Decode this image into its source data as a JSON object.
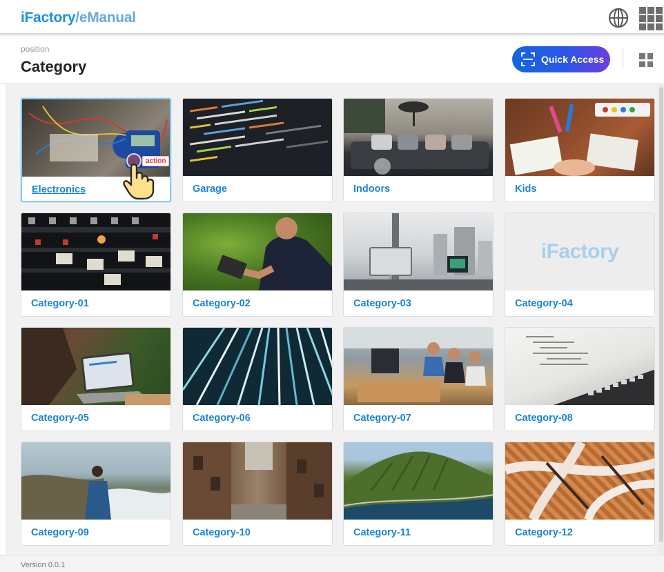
{
  "app": {
    "brand_primary": "iFactory",
    "brand_secondary": "/eManual",
    "globe_icon": "globe-icon",
    "apps_icon": "apps-grid-icon"
  },
  "header": {
    "position_label": "position",
    "title": "Category",
    "quick_access_label": "Quick Access",
    "view_toggle_icon": "grid-view-icon"
  },
  "colors": {
    "accent": "#1b84d8",
    "quick_access_gradient_start": "#1466e0",
    "quick_access_gradient_end": "#6c3fe0"
  },
  "categories": [
    {
      "label": "Electronics",
      "image": "electronics-breadboard-photo",
      "selected": true
    },
    {
      "label": "Garage",
      "image": "code-screen-photo"
    },
    {
      "label": "Indoors",
      "image": "living-room-photo"
    },
    {
      "label": "Kids",
      "image": "kids-crafts-photo"
    },
    {
      "label": "Category-01",
      "image": "audio-mixer-photo"
    },
    {
      "label": "Category-02",
      "image": "man-with-tablet-photo"
    },
    {
      "label": "Category-03",
      "image": "office-desk-photo"
    },
    {
      "label": "Category-04",
      "image": "ifactory-logo-placeholder",
      "placeholder_text": "iFactory"
    },
    {
      "label": "Category-05",
      "image": "laptop-work-photo"
    },
    {
      "label": "Category-06",
      "image": "light-streaks-photo"
    },
    {
      "label": "Category-07",
      "image": "team-office-photo"
    },
    {
      "label": "Category-08",
      "image": "laptop-code-photo"
    },
    {
      "label": "Category-09",
      "image": "coast-photo"
    },
    {
      "label": "Category-10",
      "image": "alley-photo"
    },
    {
      "label": "Category-11",
      "image": "mountain-photo"
    },
    {
      "label": "Category-12",
      "image": "rope-net-photo"
    }
  ],
  "cursor": {
    "action_tag": "action",
    "icon": "hand-pointer-icon"
  },
  "footer": {
    "version": "Version 0.0.1"
  }
}
